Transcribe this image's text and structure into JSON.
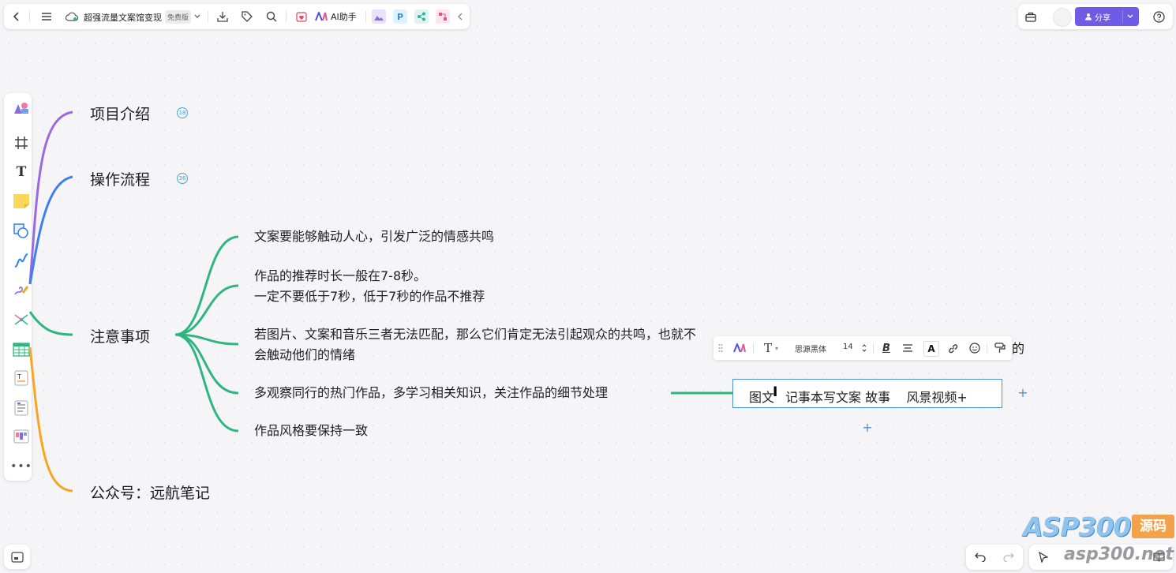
{
  "top_toolbar": {
    "doc_title": "超强流量文案馆变现",
    "plan_badge": "免费版",
    "ai_label": "AI助手"
  },
  "top_right": {
    "share_label": "分享"
  },
  "mindmap": {
    "branches": [
      {
        "label": "项目介绍",
        "badge": "18",
        "color": "#9b6ae0"
      },
      {
        "label": "操作流程",
        "badge": "36",
        "color": "#3f7ff0"
      },
      {
        "label": "注意事项",
        "color": "#2fb57f"
      },
      {
        "label": "公众号：远航笔记",
        "color": "#f5a623"
      }
    ],
    "notes": [
      {
        "lines": [
          "文案要能够触动人心，引发广泛的情感共鸣"
        ]
      },
      {
        "lines": [
          "作品的推荐时长一般在7-8秒。",
          "一定不要低于7秒，低于7秒的作品不推荐"
        ]
      },
      {
        "lines": [
          "若图片、文案和音乐三者无法匹配，那么它们肯定无法引起观众的共鸣，也就不",
          "会触动他们的情绪"
        ]
      },
      {
        "lines": [
          "多观察同行的热门作品，多学习相关知识，关注作品的细节处理"
        ]
      },
      {
        "lines": [
          "作品风格要保持一致"
        ]
      }
    ],
    "partial_char": "的",
    "editing_node": {
      "text_left": "图文",
      "text_right": "记事本写文案 故事    风景视频+"
    }
  },
  "format_toolbar": {
    "font_name": "思源黑体",
    "font_size": "14"
  },
  "watermark": {
    "logo": "ASP300",
    "logo_tag": "源码",
    "url": "asp300.net"
  }
}
